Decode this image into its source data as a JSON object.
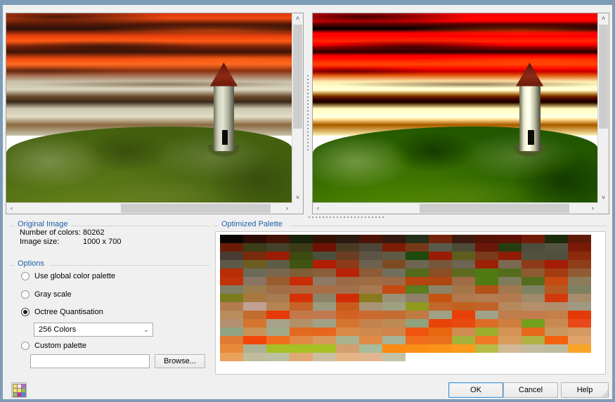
{
  "window": {
    "title": ""
  },
  "preview": {
    "original": {
      "name": "original-image-preview",
      "alt": "Sunset lighthouse painting, original"
    },
    "optimized": {
      "name": "optimized-image-preview",
      "alt": "Sunset lighthouse painting, quantised"
    },
    "scroll_up": "˄",
    "scroll_down": "˅",
    "scroll_left": "‹",
    "scroll_right": "›"
  },
  "original_group": {
    "legend": "Original Image",
    "rows": [
      {
        "label": "Number of colors:",
        "value": "80262"
      },
      {
        "label": "Image size:",
        "value": "1000 x 700"
      }
    ]
  },
  "options_group": {
    "legend": "Options",
    "radios": [
      {
        "label": "Use global color palette",
        "selected": false
      },
      {
        "label": "Gray scale",
        "selected": false
      },
      {
        "label": "Octree Quantisation",
        "selected": true
      },
      {
        "label": "Custom palette",
        "selected": false
      }
    ],
    "colors_select": {
      "value": "256 Colors",
      "arrow": "⌄"
    },
    "custom_path": {
      "value": "",
      "placeholder": ""
    },
    "browse_label": "Browse..."
  },
  "palette_group": {
    "legend": "Optimized Palette",
    "columns": 16,
    "colors": [
      "#0b0603",
      "#2a0c04",
      "#431205",
      "#17240a",
      "#331205",
      "#2b1a10",
      "#4d1305",
      "#34190f",
      "#24301a",
      "#73240a",
      "#3d1b0e",
      "#531407",
      "#5e1206",
      "#721c07",
      "#1c2b0c",
      "#601a08",
      "#6a1c07",
      "#3d3c18",
      "#45402a",
      "#3d3a16",
      "#6d1205",
      "#4b3a22",
      "#4d4638",
      "#7f1c06",
      "#763919",
      "#5a5a4a",
      "#4d4a36",
      "#6b1709",
      "#243d12",
      "#4e4c3c",
      "#565440",
      "#7a1a07",
      "#4a3c34",
      "#7a2a0c",
      "#9b1d06",
      "#3e4a10",
      "#4d4f3e",
      "#6b3d22",
      "#5c5444",
      "#5f5a46",
      "#1e4a0d",
      "#9b1c06",
      "#5d5e1e",
      "#7a3c1c",
      "#8f1d06",
      "#53513e",
      "#50503e",
      "#8c2a0c",
      "#5e5a48",
      "#6e5d22",
      "#5f5c46",
      "#3f5412",
      "#b31c05",
      "#8c3a18",
      "#6d6250",
      "#7d4a22",
      "#6f6552",
      "#77573a",
      "#6e6452",
      "#9b2206",
      "#7a6a54",
      "#8d3a18",
      "#a41c05",
      "#8f3e1a",
      "#b72e07",
      "#6a6a56",
      "#7a684e",
      "#7e5e34",
      "#8a5e3a",
      "#b92206",
      "#8d5c36",
      "#716f5c",
      "#536a1a",
      "#8c4e24",
      "#5c6b20",
      "#4e7a14",
      "#546c1c",
      "#8d5a32",
      "#a43c12",
      "#8f5c34",
      "#c03208",
      "#8a7464",
      "#9a5c2e",
      "#c92c06",
      "#8e7a64",
      "#9a6a44",
      "#a06a42",
      "#9c6a44",
      "#b54410",
      "#ad4810",
      "#9e6c46",
      "#4f7c12",
      "#7e7c5c",
      "#556c1c",
      "#c64a12",
      "#8d7c5c",
      "#7f7f64",
      "#9a7c4e",
      "#a06e46",
      "#af6a42",
      "#a86e46",
      "#a2704a",
      "#a87a52",
      "#c44a12",
      "#5d7c1e",
      "#8c8468",
      "#a47648",
      "#b25016",
      "#a2784e",
      "#7e8262",
      "#b45a22",
      "#7f8060",
      "#7a7c1e",
      "#a8793e",
      "#a87c52",
      "#d53208",
      "#8c8468",
      "#d22c06",
      "#8a7a1e",
      "#9a9278",
      "#8f8268",
      "#c4540f",
      "#b27a4c",
      "#b27e52",
      "#b27a4e",
      "#a08a6a",
      "#d23a0c",
      "#a88c6c",
      "#b27c50",
      "#c2a094",
      "#b68452",
      "#c4642a",
      "#9a9a80",
      "#c85c1c",
      "#a89476",
      "#9fa080",
      "#8f9a1e",
      "#c1682e",
      "#c2601e",
      "#c2622a",
      "#b48a5c",
      "#b4906a",
      "#b08e6c",
      "#a09880",
      "#b88c5c",
      "#c26c2e",
      "#e53a08",
      "#c4784a",
      "#c2784e",
      "#d26224",
      "#cb6a30",
      "#c46c32",
      "#be7a42",
      "#a0a086",
      "#e74008",
      "#9fa286",
      "#c07c4a",
      "#c27c4e",
      "#c48048",
      "#e33a08",
      "#b49070",
      "#d4762e",
      "#a8a288",
      "#b29068",
      "#a0a286",
      "#d4742e",
      "#c4824c",
      "#be8a56",
      "#8ea27e",
      "#e84408",
      "#e8490c",
      "#dc6c26",
      "#ce7e3e",
      "#72a01e",
      "#c98a52",
      "#e8481a",
      "#8ea484",
      "#c89258",
      "#9eaa8a",
      "#e26a20",
      "#e8661c",
      "#d88a46",
      "#cc8a4e",
      "#d0844a",
      "#ee5410",
      "#e8660f",
      "#d08c50",
      "#9cae2e",
      "#d49254",
      "#e8681a",
      "#c79860",
      "#d49a62",
      "#e07a32",
      "#f3460a",
      "#ee6e1e",
      "#e28a44",
      "#d89a5c",
      "#a8b28e",
      "#e08a46",
      "#a8b296",
      "#ee6c1c",
      "#e9701e",
      "#a4b23a",
      "#ee7a26",
      "#d69c5e",
      "#b0b246",
      "#f3600e",
      "#e0a46a",
      "#e98a3a",
      "#adb294",
      "#a8c024",
      "#a8c024",
      "#a8c024",
      "#d2a070",
      "#a6bc9a",
      "#fa8a12",
      "#fb8e16",
      "#fb9418",
      "#fb9a1c",
      "#b8bc46",
      "#d2b896",
      "#c4bc9e",
      "#bcbc9e",
      "#fba42a",
      "#e9a25a",
      "#c0bc9c",
      "#bcc0a2",
      "#e2a874",
      "#cbbfa0",
      "#e6b486",
      "#e0b68e",
      "#c4c2a6"
    ]
  },
  "footer": {
    "palette_tool": {
      "name": "palette-tool-button",
      "label": ""
    },
    "buttons": [
      {
        "label": "OK",
        "focused": true
      },
      {
        "label": "Cancel",
        "focused": false
      },
      {
        "label": "Help",
        "focused": false
      }
    ]
  }
}
